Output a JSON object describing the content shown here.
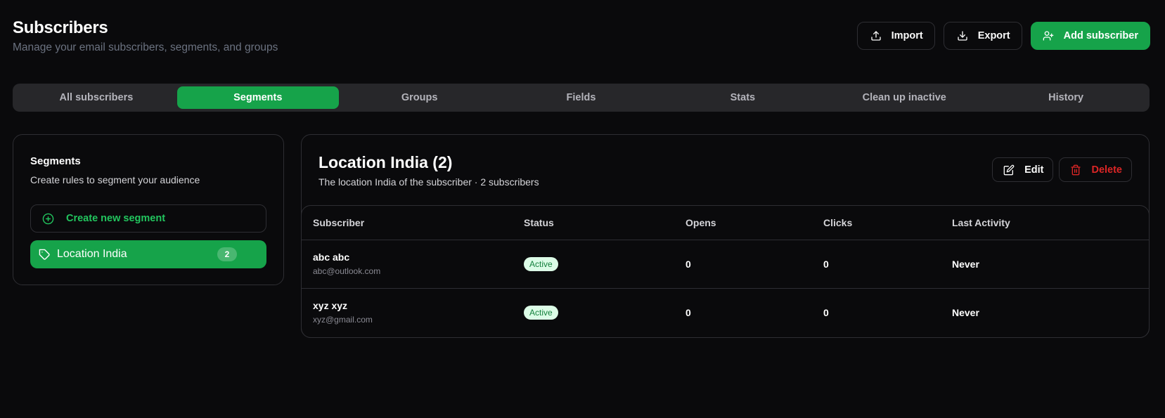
{
  "header": {
    "title": "Subscribers",
    "subtitle": "Manage your email subscribers, segments, and groups",
    "import_label": "Import",
    "export_label": "Export",
    "add_label": "Add subscriber"
  },
  "tabs": [
    {
      "label": "All subscribers",
      "active": false
    },
    {
      "label": "Segments",
      "active": true
    },
    {
      "label": "Groups",
      "active": false
    },
    {
      "label": "Fields",
      "active": false
    },
    {
      "label": "Stats",
      "active": false
    },
    {
      "label": "Clean up inactive",
      "active": false
    },
    {
      "label": "History",
      "active": false
    }
  ],
  "segments_panel": {
    "title": "Segments",
    "description": "Create rules to segment your audience",
    "create_label": "Create new segment",
    "items": [
      {
        "label": "Location India",
        "count": "2"
      }
    ]
  },
  "segment_detail": {
    "title": "Location India (2)",
    "subtitle": "The location India of the subscriber · 2 subscribers",
    "edit_label": "Edit",
    "delete_label": "Delete",
    "columns": [
      "Subscriber",
      "Status",
      "Opens",
      "Clicks",
      "Last Activity"
    ],
    "rows": [
      {
        "name": "abc abc",
        "email": "abc@outlook.com",
        "status": "Active",
        "opens": "0",
        "clicks": "0",
        "last_activity": "Never"
      },
      {
        "name": "xyz xyz",
        "email": "xyz@gmail.com",
        "status": "Active",
        "opens": "0",
        "clicks": "0",
        "last_activity": "Never"
      }
    ]
  },
  "colors": {
    "accent": "#16a34a",
    "background": "#0a0a0c",
    "danger": "#dc2626",
    "status_active_bg": "#dcfce7"
  },
  "icons": {
    "import": "upload-icon",
    "export": "download-icon",
    "add": "user-plus-icon",
    "create": "plus-circle-icon",
    "segment": "tag-icon",
    "edit": "edit-icon",
    "delete": "trash-icon"
  }
}
